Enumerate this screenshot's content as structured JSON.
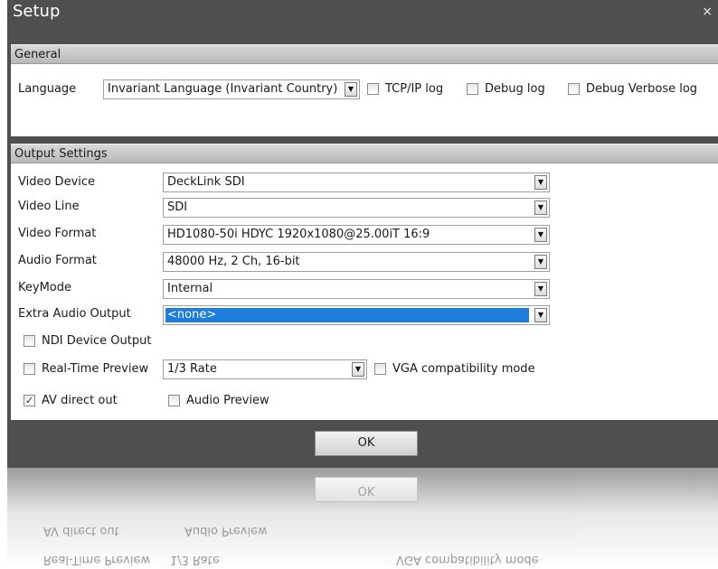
{
  "window": {
    "title": "Setup",
    "close_glyph": "×"
  },
  "general": {
    "header": "General",
    "language_label": "Language",
    "language_value": "Invariant Language (Invariant Country)",
    "tcpip_log_label": "TCP/IP log",
    "tcpip_log_checked": false,
    "debug_log_label": "Debug log",
    "debug_log_checked": false,
    "debug_verbose_label": "Debug Verbose log",
    "debug_verbose_checked": false
  },
  "output": {
    "header": "Output Settings",
    "video_device_label": "Video Device",
    "video_device_value": "DeckLink SDI",
    "video_line_label": "Video Line",
    "video_line_value": "SDI",
    "video_format_label": "Video Format",
    "video_format_value": "HD1080-50i HDYC 1920x1080@25.00iT 16:9",
    "audio_format_label": "Audio Format",
    "audio_format_value": "48000 Hz, 2 Ch, 16-bit",
    "keymode_label": "KeyMode",
    "keymode_value": "Internal",
    "extra_audio_label": "Extra Audio Output",
    "extra_audio_value": "<none>",
    "ndi_label": "NDI Device Output",
    "ndi_checked": false,
    "realtime_label": "Real-Time Preview",
    "realtime_checked": false,
    "realtime_rate_value": "1/3 Rate",
    "vga_label": "VGA compatibility mode",
    "vga_checked": false,
    "av_direct_label": "AV direct out",
    "av_direct_checked": true,
    "audio_preview_label": "Audio Preview",
    "audio_preview_checked": false
  },
  "footer": {
    "ok_label": "OK"
  },
  "colors": {
    "title_bg": "#4f4f4f",
    "selection": "#1e7ddc",
    "header_bg": "#c8c8c8"
  }
}
